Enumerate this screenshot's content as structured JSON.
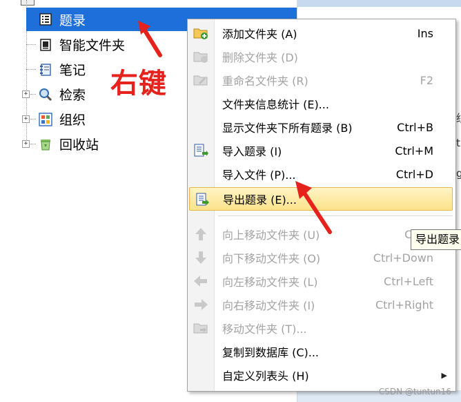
{
  "tree": {
    "top_cut_label": "",
    "items": [
      {
        "label": "题录",
        "icon": "list-doc-icon",
        "selected": true
      },
      {
        "label": "智能文件夹",
        "icon": "smart-folder-icon",
        "selected": false
      },
      {
        "label": "笔记",
        "icon": "notebook-icon",
        "selected": false
      },
      {
        "label": "检索",
        "icon": "magnifier-icon",
        "selected": false
      },
      {
        "label": "组织",
        "icon": "grid-org-icon",
        "selected": false
      },
      {
        "label": "回收站",
        "icon": "recycle-bin-icon",
        "selected": false
      }
    ],
    "expander_symbol": "+"
  },
  "annotation": {
    "right_click_text": "右键"
  },
  "right_panel": {
    "peek_texts": [
      "组",
      "th",
      "g"
    ]
  },
  "context_menu": {
    "items": [
      {
        "label": "添加文件夹 (A)",
        "shortcut": "Ins",
        "enabled": true,
        "icon": "add-folder-icon"
      },
      {
        "label": "删除文件夹 (D)",
        "shortcut": "",
        "enabled": false,
        "icon": "delete-folder-icon"
      },
      {
        "label": "重命名文件夹 (R)",
        "shortcut": "F2",
        "enabled": false,
        "icon": "rename-folder-icon"
      },
      {
        "label": "文件夹信息统计 (E)...",
        "shortcut": "",
        "enabled": true,
        "icon": ""
      },
      {
        "label": "显示文件夹下所有题录 (B)",
        "shortcut": "Ctrl+B",
        "enabled": true,
        "icon": ""
      },
      {
        "label": "导入题录 (I)",
        "shortcut": "Ctrl+M",
        "enabled": true,
        "icon": "import-refs-icon"
      },
      {
        "label": "导入文件 (P)...",
        "shortcut": "Ctrl+D",
        "enabled": true,
        "icon": ""
      },
      {
        "label": "导出题录 (E)...",
        "shortcut": "",
        "enabled": true,
        "highlighted": true,
        "icon": "export-refs-icon"
      },
      {
        "label": "向上移动文件夹 (U)",
        "shortcut": "Ctrl+",
        "enabled": false,
        "icon": "arrow-up-icon"
      },
      {
        "label": "向下移动文件夹 (O)",
        "shortcut": "Ctrl+Down",
        "enabled": false,
        "icon": "arrow-down-icon"
      },
      {
        "label": "向左移动文件夹 (L)",
        "shortcut": "Ctrl+Left",
        "enabled": false,
        "icon": "arrow-left-icon"
      },
      {
        "label": "向右移动文件夹 (I)",
        "shortcut": "Ctrl+Right",
        "enabled": false,
        "icon": "arrow-right-icon"
      },
      {
        "label": "移动文件夹 (T)...",
        "shortcut": "",
        "enabled": false,
        "icon": "move-folder-icon"
      },
      {
        "label": "复制到数据库 (C)...",
        "shortcut": "",
        "enabled": true,
        "icon": ""
      },
      {
        "label": "自定义列表头 (H)",
        "shortcut": "",
        "enabled": true,
        "icon": "",
        "submenu": true
      }
    ],
    "submenu_glyph": "▶"
  },
  "tooltip": {
    "text": "导出题录"
  },
  "watermark": "CSDN @tuntun16",
  "colors": {
    "selection_blue": "#1e6fd9",
    "highlight_gold": "#fce28a",
    "annotation_red": "#e5221b"
  }
}
